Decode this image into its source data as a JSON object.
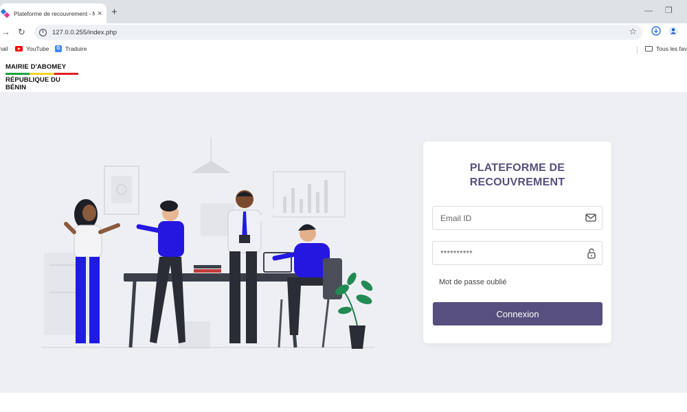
{
  "browser": {
    "tab": {
      "title": "Plateforme de recouvrement - M",
      "close_glyph": "×"
    },
    "newtab_glyph": "+",
    "url": "127.0.0.255/index.php",
    "bookmarks": [
      {
        "label": "mail",
        "icon": "mail-icon"
      },
      {
        "label": "YouTube",
        "icon": "youtube-icon"
      },
      {
        "label": "Traduire",
        "icon": "translate-icon"
      }
    ],
    "bookmarks_folder": "Tous les favoris",
    "colors": {
      "tabbar": "#dee1e6",
      "omnibox": "#edf0f5"
    }
  },
  "site": {
    "brand_line1": "MAIRIE D'ABOMEY",
    "brand_line2": "RÉPUBLIQUE DU BÉNIN",
    "flag_colors": [
      "#1aa33b",
      "#f8d12c",
      "#e01d22"
    ]
  },
  "login": {
    "title": "PLATEFORME DE\nRECOUVREMENT",
    "email_placeholder": "Email ID",
    "password_value": "**********",
    "forgot_label": "Mot de passe oublié",
    "submit_label": "Connexion",
    "colors": {
      "accent": "#574f7d",
      "background": "#edeff3"
    }
  }
}
